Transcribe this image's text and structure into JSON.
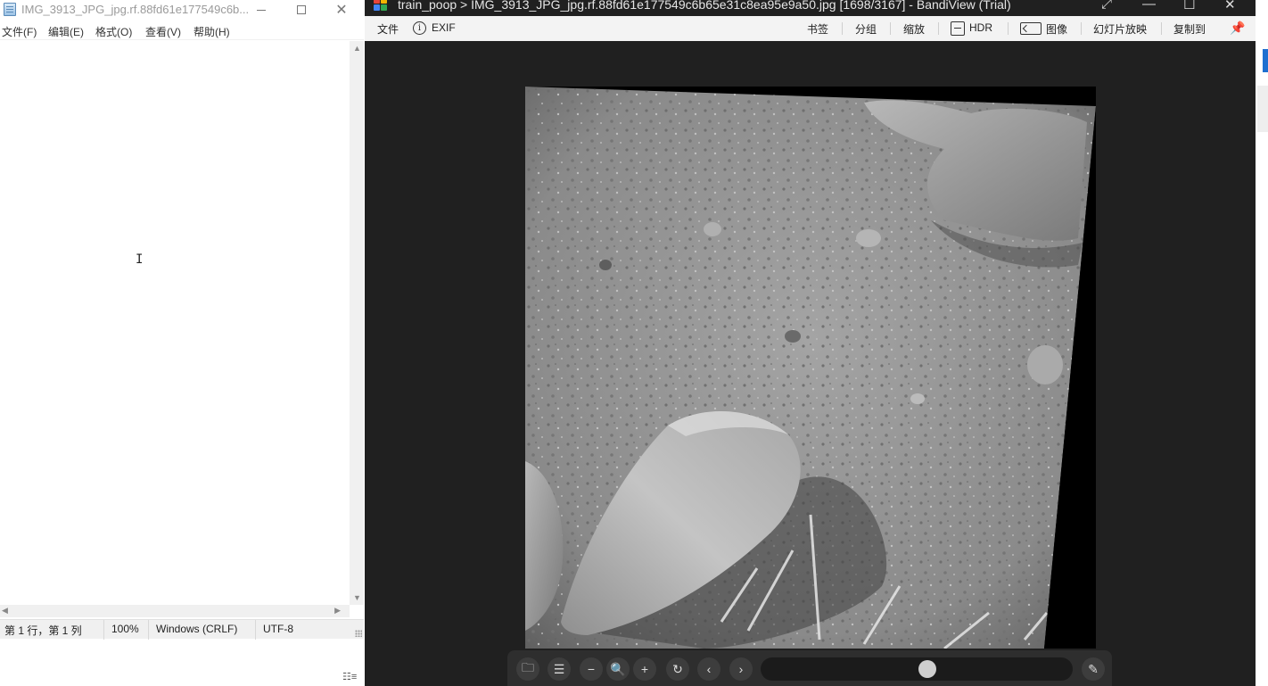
{
  "notepad": {
    "title": "IMG_3913_JPG_jpg.rf.88fd61e177549c6b...",
    "menu": [
      "文件(F)",
      "编辑(E)",
      "格式(O)",
      "查看(V)",
      "帮助(H)"
    ],
    "content": "",
    "status": {
      "position": "第 1 行，第 1 列",
      "zoom": "100%",
      "line_ending": "Windows (CRLF)",
      "encoding": "UTF-8"
    }
  },
  "bandiview": {
    "title": "train_poop > IMG_3913_JPG_jpg.rf.88fd61e177549c6b65e31c8ea95e9a50.jpg [1698/3167] - BandiView (Trial)",
    "toolbar": {
      "file": "文件",
      "exif": "EXIF",
      "bookmark": "书签",
      "group": "分组",
      "zoom": "缩放",
      "hdr": "HDR",
      "image": "图像",
      "slideshow": "幻灯片放映",
      "copy_to": "复制到"
    },
    "navigation": {
      "current": 1698,
      "total": 3167
    },
    "bottom_icons": [
      "folder-open-icon",
      "list-icon",
      "zoom-out-icon",
      "zoom-search-icon",
      "zoom-in-icon",
      "rotate-icon",
      "prev-icon",
      "next-icon",
      "pin-icon"
    ]
  },
  "colors": {
    "viewer_bg": "#202020",
    "toolbar_bg": "#f3f3f3",
    "accent_blue": "#1e6fd0"
  }
}
